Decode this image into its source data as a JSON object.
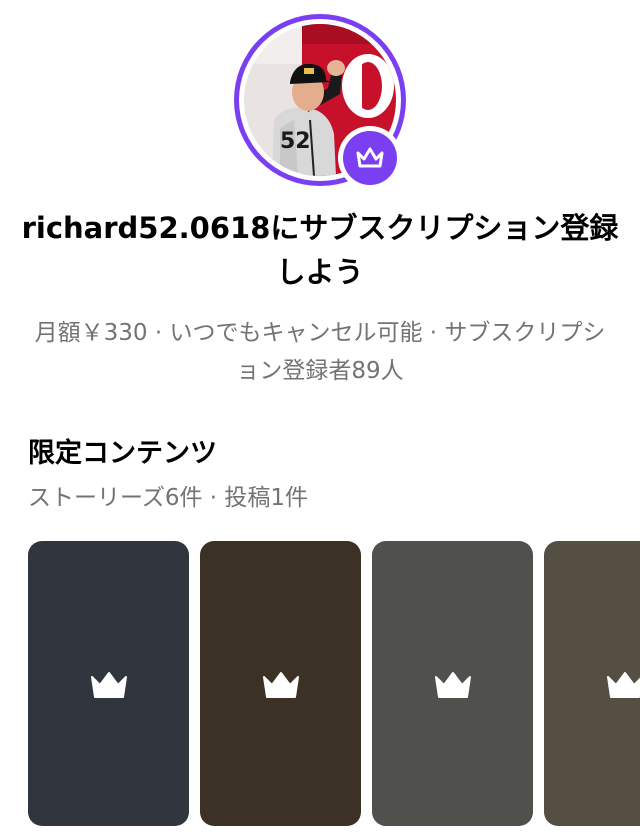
{
  "profile": {
    "title": "richard52.0618にサブスクリプション登録しよう",
    "details": "月額￥330 · いつでもキャンセル可能 · サブスクリプション登録者89人",
    "accent_color": "#7b3ff2",
    "badge_icon": "crown-icon",
    "avatar_jersey_number": "52"
  },
  "exclusive": {
    "heading": "限定コンテンツ",
    "meta": "ストーリーズ6件 · 投稿1件",
    "cards": [
      {
        "color": "#30353e",
        "icon": "crown-icon"
      },
      {
        "color": "#3b3124",
        "icon": "crown-icon"
      },
      {
        "color": "#50504c",
        "icon": "crown-icon"
      },
      {
        "color": "#544f42",
        "icon": "crown-icon"
      }
    ]
  }
}
